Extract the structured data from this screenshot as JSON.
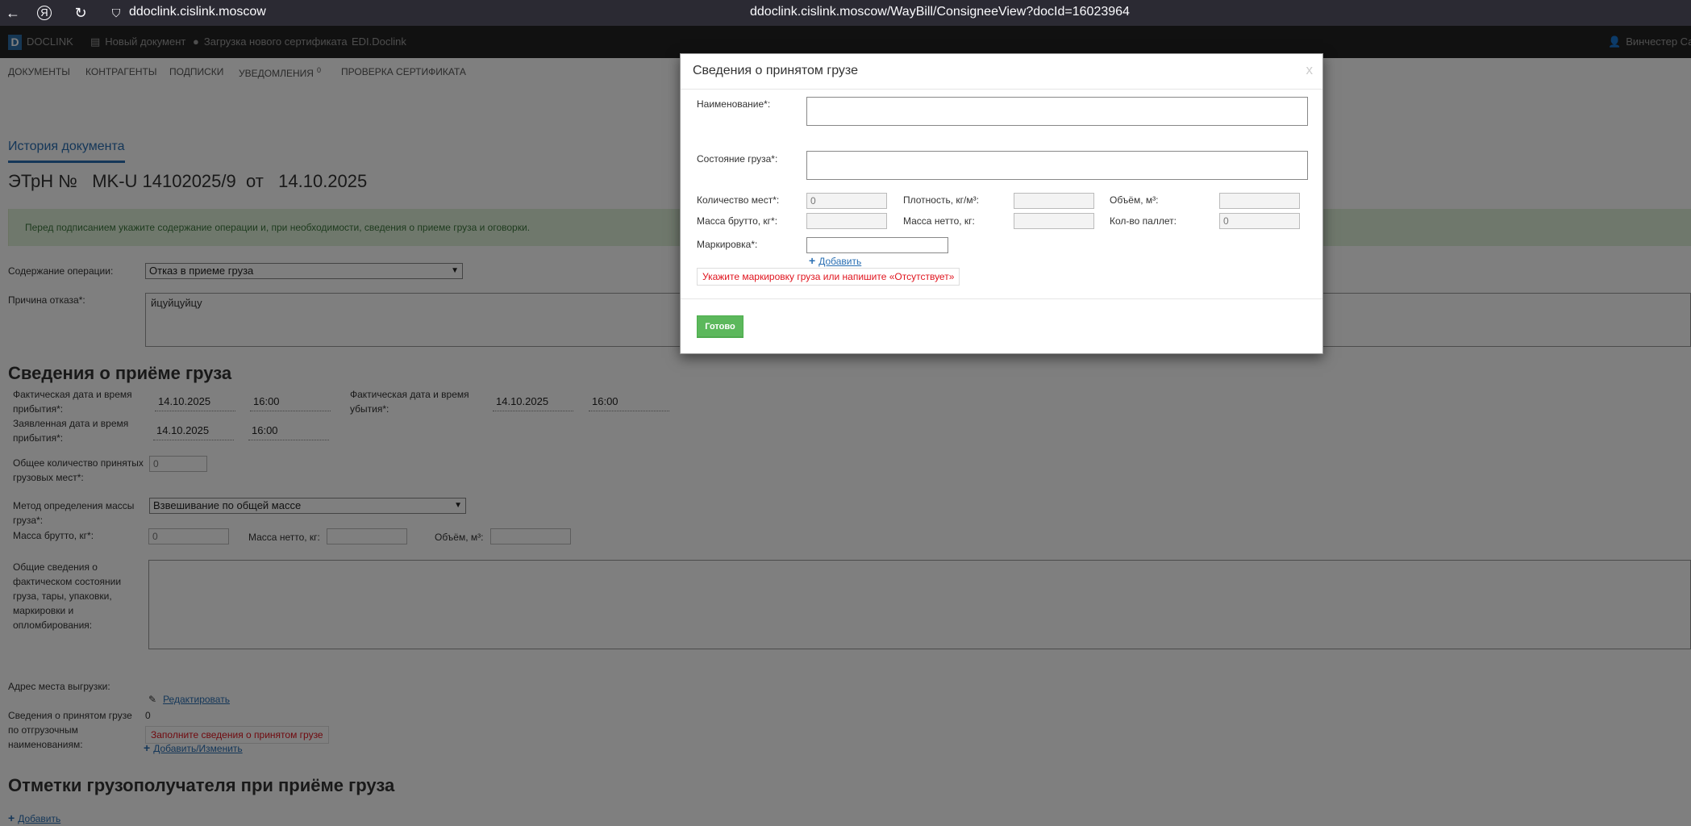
{
  "browser": {
    "url_host": "ddoclink.cislink.moscow",
    "url_full": "ddoclink.cislink.moscow/WayBill/ConsigneeView?docId=16023964"
  },
  "app_bar": {
    "logo_letter": "D",
    "brand": "DOCLINK",
    "new_doc": "Новый документ",
    "load_cert": "Загрузка нового сертификата",
    "edi": "EDI.Doclink",
    "user": "Винчестер Сам"
  },
  "nav": {
    "documents": "ДОКУМЕНТЫ",
    "contractors": "КОНТРАГЕНТЫ",
    "signatures": "ПОДПИСКИ",
    "notifications": "УВЕДОМЛЕНИЯ",
    "notifications_count": "0",
    "cert_check": "ПРОВЕРКА СЕРТИФИКАТА"
  },
  "page": {
    "history_tab": "История документа",
    "doc_title": "ЭТрН №   MK-U 14102025/9  от   14.10.2025",
    "alert": "Перед подписанием укажите содержание операции и, при необходимости, сведения о приеме груза и оговорки.",
    "operation_label": "Содержание операции:",
    "operation_value": "Отказ в приеме груза",
    "refuse_reason_label": "Причина отказа*:",
    "refuse_reason_value": "йцуйцуйцу",
    "section_receipt": "Сведения о приёме груза",
    "arrival_label": "Фактическая дата и время прибытия*:",
    "arrival_date": "14.10.2025",
    "arrival_time": "16:00",
    "departure_label": "Фактическая дата и время убытия*:",
    "departure_date": "14.10.2025",
    "departure_time": "16:00",
    "declared_label": "Заявленная дата и время прибытия*:",
    "declared_date": "14.10.2025",
    "declared_time": "16:00",
    "total_places_label": "Общее количество принятых грузовых мест*:",
    "total_places_value": "0",
    "mass_method_label": "Метод определения массы груза*:",
    "mass_method_value": "Взвешивание по общей массе",
    "gross_label": "Масса брутто, кг*:",
    "gross_value": "0",
    "net_label": "Масса нетто, кг:",
    "volume_label": "Объём, м³:",
    "general_state_label": "Общие сведения о фактическом состоянии груза, тары, упаковки, маркировки и опломбирования:",
    "unload_address_label": "Адрес места выгрузки:",
    "edit_link": "Редактировать",
    "received_info_label": "Сведения о принятом грузе по отгрузочным наименованиям:",
    "received_info_count": "0",
    "received_info_error": "Заполните сведения о принятом грузе",
    "add_change_link": "Добавить/Изменить",
    "section_marks": "Отметки грузополучателя при приёме груза",
    "add_link": "Добавить"
  },
  "modal": {
    "title": "Сведения о принятом грузе",
    "close": "x",
    "name_label": "Наименование*:",
    "state_label": "Состояние груза*:",
    "places_label": "Количество мест*:",
    "places_value": "0",
    "density_label": "Плотность, кг/м³:",
    "volume_label": "Объём, м³:",
    "gross_label": "Масса брутто, кг*:",
    "net_label": "Масса нетто, кг:",
    "pallets_label": "Кол-во паллет:",
    "pallets_value": "0",
    "marking_label": "Маркировка*:",
    "add_link": "Добавить",
    "marking_error": "Укажите маркировку груза или напишите «Отсутствует»",
    "done_button": "Готово"
  }
}
